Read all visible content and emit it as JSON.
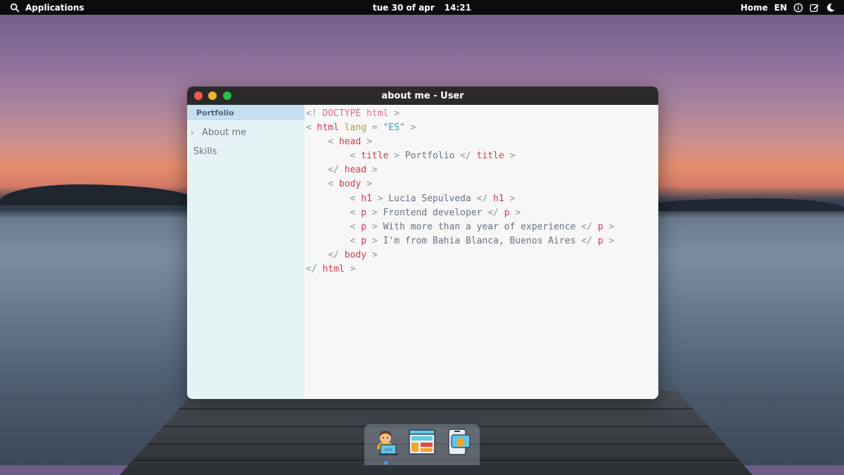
{
  "topbar": {
    "applications_label": "Applications",
    "date": "tue 30 of apr",
    "time": "14:21",
    "home_label": "Home",
    "language": "EN"
  },
  "window": {
    "title": "about me - User",
    "sidebar": {
      "header": "Portfolio",
      "items": [
        {
          "label": "About me",
          "expanded": false
        },
        {
          "label": "Skills"
        }
      ]
    },
    "editor": {
      "lines": [
        {
          "t1": "<!",
          "t2": "DOCTYPE html",
          "t3": ">"
        },
        {
          "open": "<",
          "tag": "html",
          "attr": "lang",
          "eq": "=",
          "val": "\"ES\"",
          "close": ">"
        },
        {
          "open": "<",
          "tag": "head",
          "close": ">"
        },
        {
          "open": "<",
          "tag": "title",
          "close": ">",
          "text": "Portfolio",
          "copen": "</",
          "ctag": "title",
          "cclose": ">"
        },
        {
          "open": "</",
          "tag": "head",
          "close": ">"
        },
        {
          "open": "<",
          "tag": "body",
          "close": ">"
        },
        {
          "open": "<",
          "tag": "h1",
          "close": ">",
          "text": "Lucia Sepulveda",
          "copen": "</",
          "ctag": "h1",
          "cclose": ">"
        },
        {
          "open": "<",
          "tag": "p",
          "close": ">",
          "text": "Frontend developer",
          "copen": "</",
          "ctag": "p",
          "cclose": ">"
        },
        {
          "open": "<",
          "tag": "p",
          "close": ">",
          "text": "With more than a year of experience",
          "copen": "</",
          "ctag": "p",
          "cclose": ">"
        },
        {
          "open": "<",
          "tag": "p",
          "close": ">",
          "text": "I'm from Bahia Blanca, Buenos Aires",
          "copen": "</",
          "ctag": "p",
          "cclose": ">"
        },
        {
          "open": "</",
          "tag": "body",
          "close": ">"
        },
        {
          "open": "</",
          "tag": "html",
          "close": ">"
        }
      ]
    }
  },
  "dock": {
    "apps": [
      {
        "icon": "developer-avatar-icon",
        "active": true
      },
      {
        "icon": "browser-layout-icon",
        "active": false
      },
      {
        "icon": "notification-phone-icon",
        "active": false
      }
    ]
  },
  "colors": {
    "topbar_bg": "#0c0c0c",
    "titlebar_bg": "#2a2a2a",
    "sidebar_bg": "#e6f3f5",
    "sidebar_header_bg": "#c3dff0",
    "tag_color": "#d33a50",
    "attr_color": "#b0a040",
    "string_color": "#2a9fb5",
    "close_button": "#f15a50",
    "minimize_button": "#f6b22e",
    "maximize_button": "#27c13f"
  }
}
